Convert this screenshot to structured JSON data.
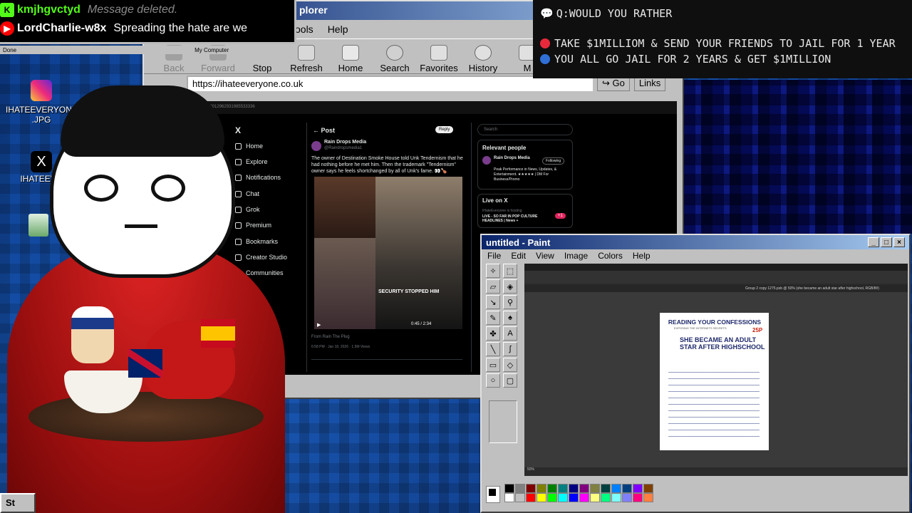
{
  "chat": {
    "messages": [
      {
        "user": "kmjhgvctyd",
        "text": "Message deleted.",
        "badge": "K",
        "badge_color": "#53fc18",
        "user_color": "#53fc18",
        "deleted": true
      },
      {
        "user": "LordCharlie-w8x",
        "text": "Spreading the hate are we",
        "badge": "▶",
        "badge_color": "#ff0000",
        "user_color": "#ffffff",
        "deleted": false
      }
    ],
    "status_done": "Done",
    "status_zone": "My Computer"
  },
  "poll": {
    "question": "Q:WOULD YOU RATHER",
    "option_red": "TAKE $1MILLIOM & SEND YOUR FRIENDS TO JAIL FOR 1 YEAR",
    "option_blue": "YOU ALL GO JAIL FOR 2 YEARS & GET $1MILLION",
    "red": "#e8293b",
    "blue": "#2f6fd6"
  },
  "desktop": {
    "icons": [
      {
        "label": "IHATEEVERYONE .JPG",
        "icon": "instagram-icon"
      },
      {
        "label": "IHATEEV...",
        "icon": "x-logo-icon"
      }
    ]
  },
  "ie": {
    "title": "plorer",
    "menu": [
      "ools",
      "Help"
    ],
    "toolbar": [
      {
        "label": "Back",
        "icon": "back-arrow-icon",
        "enabled": false
      },
      {
        "label": "Forward",
        "icon": "forward-arrow-icon",
        "enabled": false
      },
      {
        "label": "Stop",
        "icon": "stop-icon",
        "enabled": true
      },
      {
        "label": "Refresh",
        "icon": "refresh-icon",
        "enabled": true
      },
      {
        "label": "Home",
        "icon": "home-icon",
        "enabled": true
      },
      {
        "label": "Search",
        "icon": "search-icon",
        "enabled": true
      },
      {
        "label": "Favorites",
        "icon": "favorites-icon",
        "enabled": true
      },
      {
        "label": "History",
        "icon": "history-icon",
        "enabled": true
      },
      {
        "label": "M",
        "icon": "mail-icon",
        "enabled": true
      }
    ],
    "address": "https://ihateeveryone.co.uk",
    "go": "Go",
    "links": "Links"
  },
  "twitter": {
    "url": "x.com/raindropsmedia/status/2012962931985533336",
    "nav": [
      "Home",
      "Explore",
      "Notifications",
      "Chat",
      "Grok",
      "Premium",
      "Bookmarks",
      "Creator Studio",
      "Communities"
    ],
    "post_header": "Post",
    "reply": "Reply",
    "author": "Rain Drops Media",
    "handle": "@Raindropsmedia1",
    "text": "The owner of Destination Smoke House told Unk Tendernism that he had nothing before he met him. Then the trademark \"Tendernism\" owner says he feels shortchanged by all of Unk's fame. 👀🍗",
    "image_caption": "SECURITY STOPPED HIM",
    "video_time": "0:45 / 2:34",
    "from": "From Rain The Plug",
    "timestamp": "6:58 PM · Jan 18, 2026 · 1.5M Views",
    "search_placeholder": "Search",
    "relevant_title": "Relevant people",
    "relevant_name": "Rain Drops Media",
    "relevant_bio": "Peak Performance in News, Updates, & Entertainment. ★★★★★ | DM For Business/Promo",
    "follow_label": "Following",
    "live_title": "Live on X",
    "live_host": "IHateEveryone is hosting",
    "live_text": "LIVE - SO FAR IN POP CULTURE HEADLINES | News +",
    "live_count": "+1"
  },
  "paint": {
    "title": "untitled - Paint",
    "menu": [
      "File",
      "Edit",
      "View",
      "Image",
      "Colors",
      "Help"
    ],
    "palette": [
      "#000000",
      "#808080",
      "#800000",
      "#808000",
      "#008000",
      "#008080",
      "#000080",
      "#800080",
      "#808040",
      "#004040",
      "#0080ff",
      "#004080",
      "#8000ff",
      "#804000",
      "#ffffff",
      "#c0c0c0",
      "#ff0000",
      "#ffff00",
      "#00ff00",
      "#00ffff",
      "#0000ff",
      "#ff00ff",
      "#ffff80",
      "#00ff80",
      "#80ffff",
      "#8080ff",
      "#ff0080",
      "#ff8040"
    ],
    "ps_tab": "Group 2 copy 1275.psb @ 50% (she became an adult star after highschool, RGB/8#)",
    "ps_zoom": "50%"
  },
  "confession": {
    "header": "READING YOUR CONFESSIONS",
    "sub": "EXPOSING THE INTERNETS SECRETS",
    "number": "25P",
    "headline": "SHE BECAME AN ADULT STAR AFTER HIGHSCHOOL"
  },
  "tray": {
    "start": "St"
  }
}
